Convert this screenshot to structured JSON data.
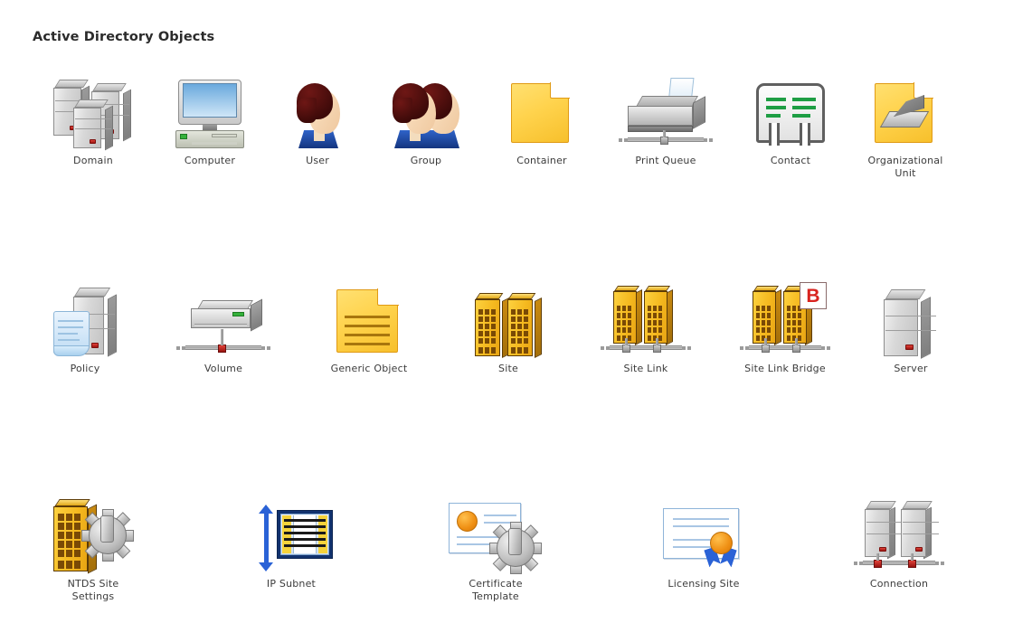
{
  "page": {
    "title": "Active Directory Objects",
    "background_color": "#ffffff",
    "title_color": "#2b2b2b"
  },
  "palette": {
    "folder_yellow": "#ffd34d",
    "folder_border": "#e09a14",
    "building_gold": "#f5b91f",
    "building_border": "#5d3c06",
    "server_grey": "#d9d9d9",
    "led_red": "#e2433a",
    "badge_red": "#d8231f",
    "contact_green": "#1e9e44",
    "cert_blue": "#a9c6e4",
    "subnet_blue": "#1f4fa8",
    "seal_orange": "#ef8f13",
    "shirt_blue": "#2f63c9",
    "hair_maroon": "#3d0a09",
    "label_color": "#3b3b3b"
  },
  "rows": [
    {
      "id": "row-1",
      "items": [
        {
          "icon": "domain-icon",
          "label": "Domain"
        },
        {
          "icon": "computer-icon",
          "label": "Computer"
        },
        {
          "icon": "user-icon",
          "label": "User"
        },
        {
          "icon": "group-icon",
          "label": "Group"
        },
        {
          "icon": "container-icon",
          "label": "Container"
        },
        {
          "icon": "print-queue-icon",
          "label": "Print Queue"
        },
        {
          "icon": "contact-icon",
          "label": "Contact"
        },
        {
          "icon": "organizational-unit-icon",
          "label": "Organizational\nUnit"
        }
      ]
    },
    {
      "id": "row-2",
      "items": [
        {
          "icon": "policy-icon",
          "label": "Policy"
        },
        {
          "icon": "volume-icon",
          "label": "Volume"
        },
        {
          "icon": "generic-object-icon",
          "label": "Generic Object"
        },
        {
          "icon": "site-icon",
          "label": "Site"
        },
        {
          "icon": "site-link-icon",
          "label": "Site Link"
        },
        {
          "icon": "site-link-bridge-icon",
          "label": "Site Link Bridge",
          "badge": "B"
        },
        {
          "icon": "server-icon",
          "label": "Server"
        }
      ]
    },
    {
      "id": "row-3",
      "items": [
        {
          "icon": "ntds-site-settings-icon",
          "label": "NTDS Site\nSettings"
        },
        {
          "icon": "ip-subnet-icon",
          "label": "IP Subnet"
        },
        {
          "icon": "certificate-template-icon",
          "label": "Certificate\nTemplate"
        },
        {
          "icon": "licensing-site-icon",
          "label": "Licensing Site"
        },
        {
          "icon": "connection-icon",
          "label": "Connection"
        }
      ]
    }
  ]
}
